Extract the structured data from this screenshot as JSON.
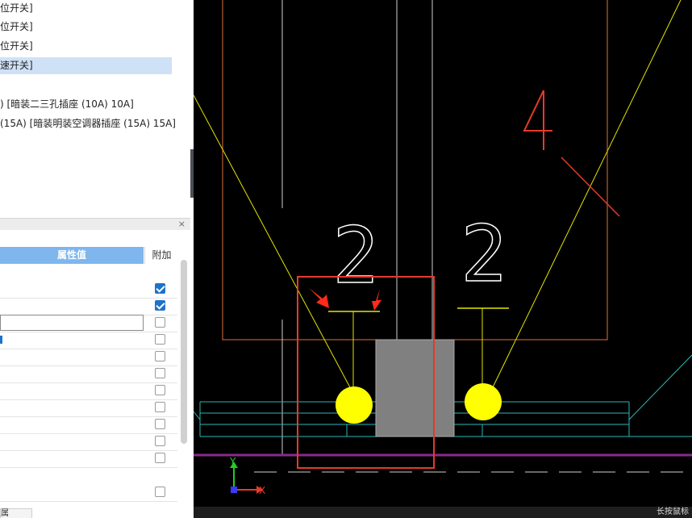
{
  "tree": {
    "items": [
      {
        "label": "位开关]",
        "selected": false
      },
      {
        "label": "位开关]",
        "selected": false
      },
      {
        "label": "位开关]",
        "selected": false
      },
      {
        "label": "速开关]",
        "selected": true
      },
      {
        "label": ") [暗装二三孔插座 (10A) 10A]",
        "selected": false
      },
      {
        "label": "(15A) [暗装明装空调器插座 (15A) 15A]",
        "selected": false
      }
    ]
  },
  "panel": {
    "close_glyph": "×",
    "col_value": "属性值",
    "col_extra": "附加",
    "rows": [
      {
        "checked": true
      },
      {
        "checked": true
      },
      {
        "checked": false,
        "editing": true
      },
      {
        "checked": false,
        "mark": true
      },
      {
        "checked": false
      },
      {
        "checked": false
      },
      {
        "checked": false
      },
      {
        "checked": false
      },
      {
        "checked": false
      },
      {
        "checked": false
      },
      {
        "checked": false
      },
      {
        "checked": false
      }
    ],
    "bottom_tab": "属"
  },
  "canvas": {
    "colors": {
      "background": "#000000",
      "orange": "#e0703a",
      "yellow": "#ffff00",
      "cyan": "#2ab7b7",
      "purple": "#8a2a8a",
      "white": "#ffffff",
      "gray_block": "#808080",
      "red": "#e53a2a"
    },
    "labels": {
      "num_left": "2",
      "num_right": "2",
      "num_four": "4",
      "axis_x": "X",
      "axis_y": "Y"
    }
  },
  "statusbar": {
    "text": "长按鼠标"
  }
}
